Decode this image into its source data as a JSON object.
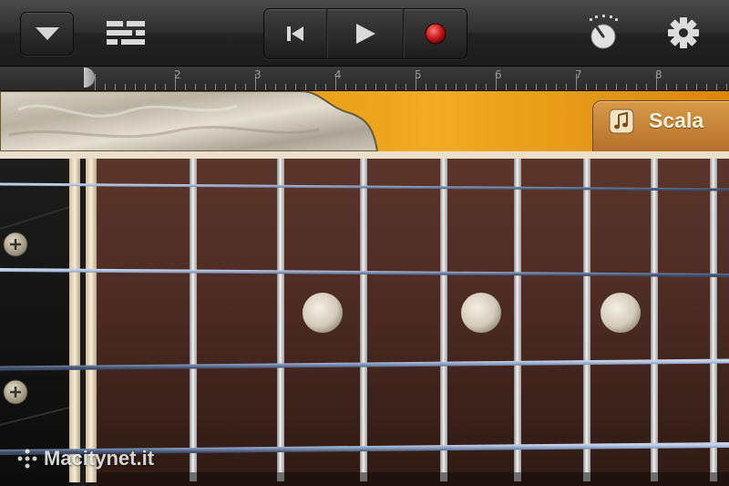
{
  "toolbar": {
    "icons": {
      "dropdown": "chevron-down-icon",
      "tracks": "tracks-view-icon",
      "rewind": "rewind-icon",
      "play": "play-icon",
      "record": "record-icon",
      "metronome": "metronome-knob-icon",
      "settings": "gear-icon"
    },
    "colors": {
      "record": "#c81a1a"
    }
  },
  "ruler": {
    "marks": [
      "2",
      "3",
      "4",
      "5",
      "6",
      "7",
      "8"
    ]
  },
  "scale_tab": {
    "label": "Scala",
    "icon": "music-note-icon"
  },
  "fretboard": {
    "strings": 4,
    "inlay_markers": 3,
    "colors": {
      "wood": "#4a2b22",
      "fret": "#d8d8d8",
      "string": "#8fa3c2"
    }
  },
  "watermark": {
    "text": "Macitynet.it"
  }
}
